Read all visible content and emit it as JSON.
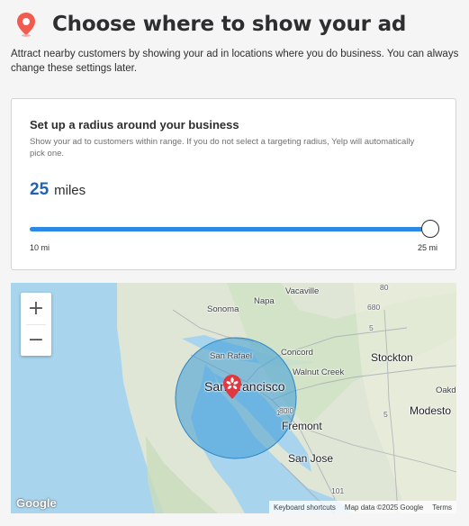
{
  "header": {
    "title": "Choose where to show your ad",
    "icon": "map-pin-icon",
    "accent_color": "#f15c4f"
  },
  "subtitle": "Attract nearby customers by showing your ad in locations where you do business. You can always change these settings later.",
  "radius_card": {
    "title": "Set up a radius around your business",
    "description": "Show your ad to customers within range. If you do not select a targeting radius, Yelp will automatically pick one.",
    "radius_value": "25",
    "radius_unit": "miles",
    "slider": {
      "min_label": "10 mi",
      "max_label": "25 mi",
      "fraction": 1.0,
      "fill_color": "#2a8ae6"
    }
  },
  "map": {
    "zoom_in": "+",
    "zoom_out": "−",
    "places": {
      "sonoma": "Sonoma",
      "napa": "Napa",
      "vacaville": "Vacaville",
      "concord": "Concord",
      "san_rafael": "San Rafael",
      "walnut_creek": "Walnut Creek",
      "stockton": "Stockton",
      "san_francisco": "San Francisco",
      "oakland": "Oakd",
      "fremont": "Fremont",
      "modesto": "Modesto",
      "san_jose": "San Jose"
    },
    "road_shields": {
      "r680": "680",
      "r80": "80",
      "r5a": "5",
      "r5b": "5",
      "r580": "580",
      "r101": "101",
      "r1": "1",
      "r80b": "80"
    },
    "logo": "Google",
    "attribution": {
      "keyboard": "Keyboard shortcuts",
      "map_data": "Map data ©2025 Google",
      "terms": "Terms"
    },
    "marker_icon": "yelp-burst-marker-icon",
    "radius_color": "#3a9bd8"
  }
}
